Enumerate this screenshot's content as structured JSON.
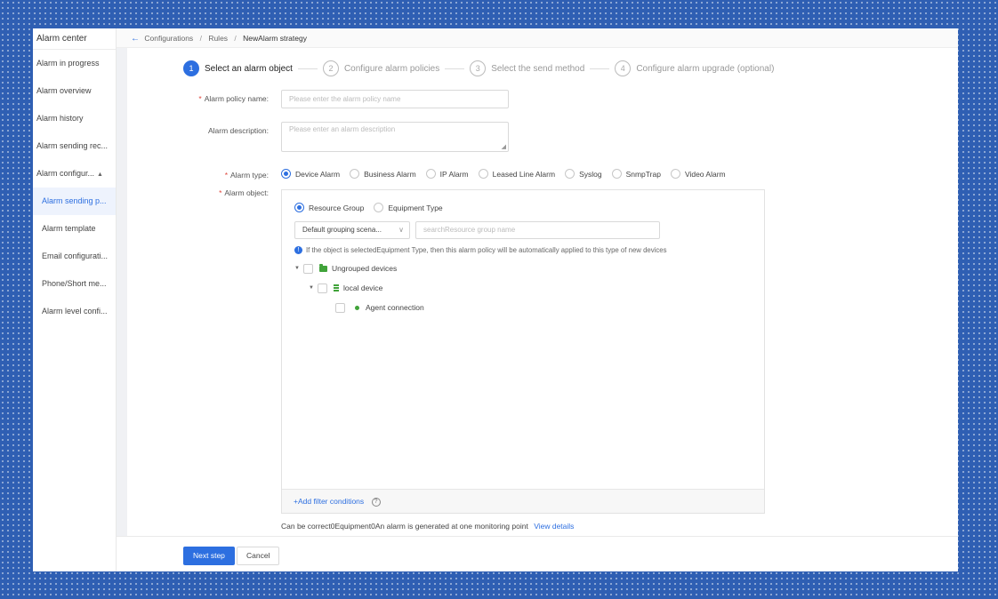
{
  "sidebar": {
    "title": "Alarm center",
    "items": [
      {
        "label": "Alarm in progress"
      },
      {
        "label": "Alarm overview"
      },
      {
        "label": "Alarm history"
      },
      {
        "label": "Alarm sending rec..."
      },
      {
        "label": "Alarm configur...",
        "expanded": true
      },
      {
        "label": "Alarm sending p...",
        "active": true
      },
      {
        "label": "Alarm template"
      },
      {
        "label": "Email configurati..."
      },
      {
        "label": "Phone/Short me..."
      },
      {
        "label": "Alarm level confi..."
      }
    ]
  },
  "breadcrumb": {
    "items": [
      "Configurations",
      "Rules",
      "NewAlarm strategy"
    ],
    "separator": "/"
  },
  "steps": [
    {
      "num": "1",
      "label": "Select an alarm object",
      "active": true
    },
    {
      "num": "2",
      "label": "Configure alarm policies"
    },
    {
      "num": "3",
      "label": "Select the send method"
    },
    {
      "num": "4",
      "label": "Configure alarm upgrade (optional)"
    }
  ],
  "form": {
    "policy_name": {
      "label": "Alarm policy name:",
      "placeholder": "Please enter the alarm policy name"
    },
    "description": {
      "label": "Alarm description:",
      "placeholder": "Please enter an alarm description"
    },
    "alarm_type": {
      "label": "Alarm type:",
      "options": [
        "Device Alarm",
        "Business Alarm",
        "IP Alarm",
        "Leased Line Alarm",
        "Syslog",
        "SnmpTrap",
        "Video Alarm"
      ],
      "selected": "Device Alarm"
    },
    "alarm_object": {
      "label": "Alarm object:",
      "modes": [
        "Resource Group",
        "Equipment Type"
      ],
      "selected_mode": "Resource Group",
      "grouping_select": "Default grouping scena...",
      "search_placeholder": "searchResource group name",
      "info": "If the object is selectedEquipment Type, then this alarm policy will be automatically applied to this type of new devices",
      "tree": {
        "root": "Ungrouped devices",
        "child": "local device",
        "leaf": "Agent connection"
      },
      "add_filter": "+Add filter conditions"
    },
    "note": "Can be correct0Equipment0An alarm is generated at one monitoring point",
    "note_link": "View details"
  },
  "buttons": {
    "next": "Next step",
    "cancel": "Cancel"
  },
  "colors": {
    "accent": "#2d6fe0",
    "required": "#e0473d",
    "tree_icon": "#41a33a"
  }
}
